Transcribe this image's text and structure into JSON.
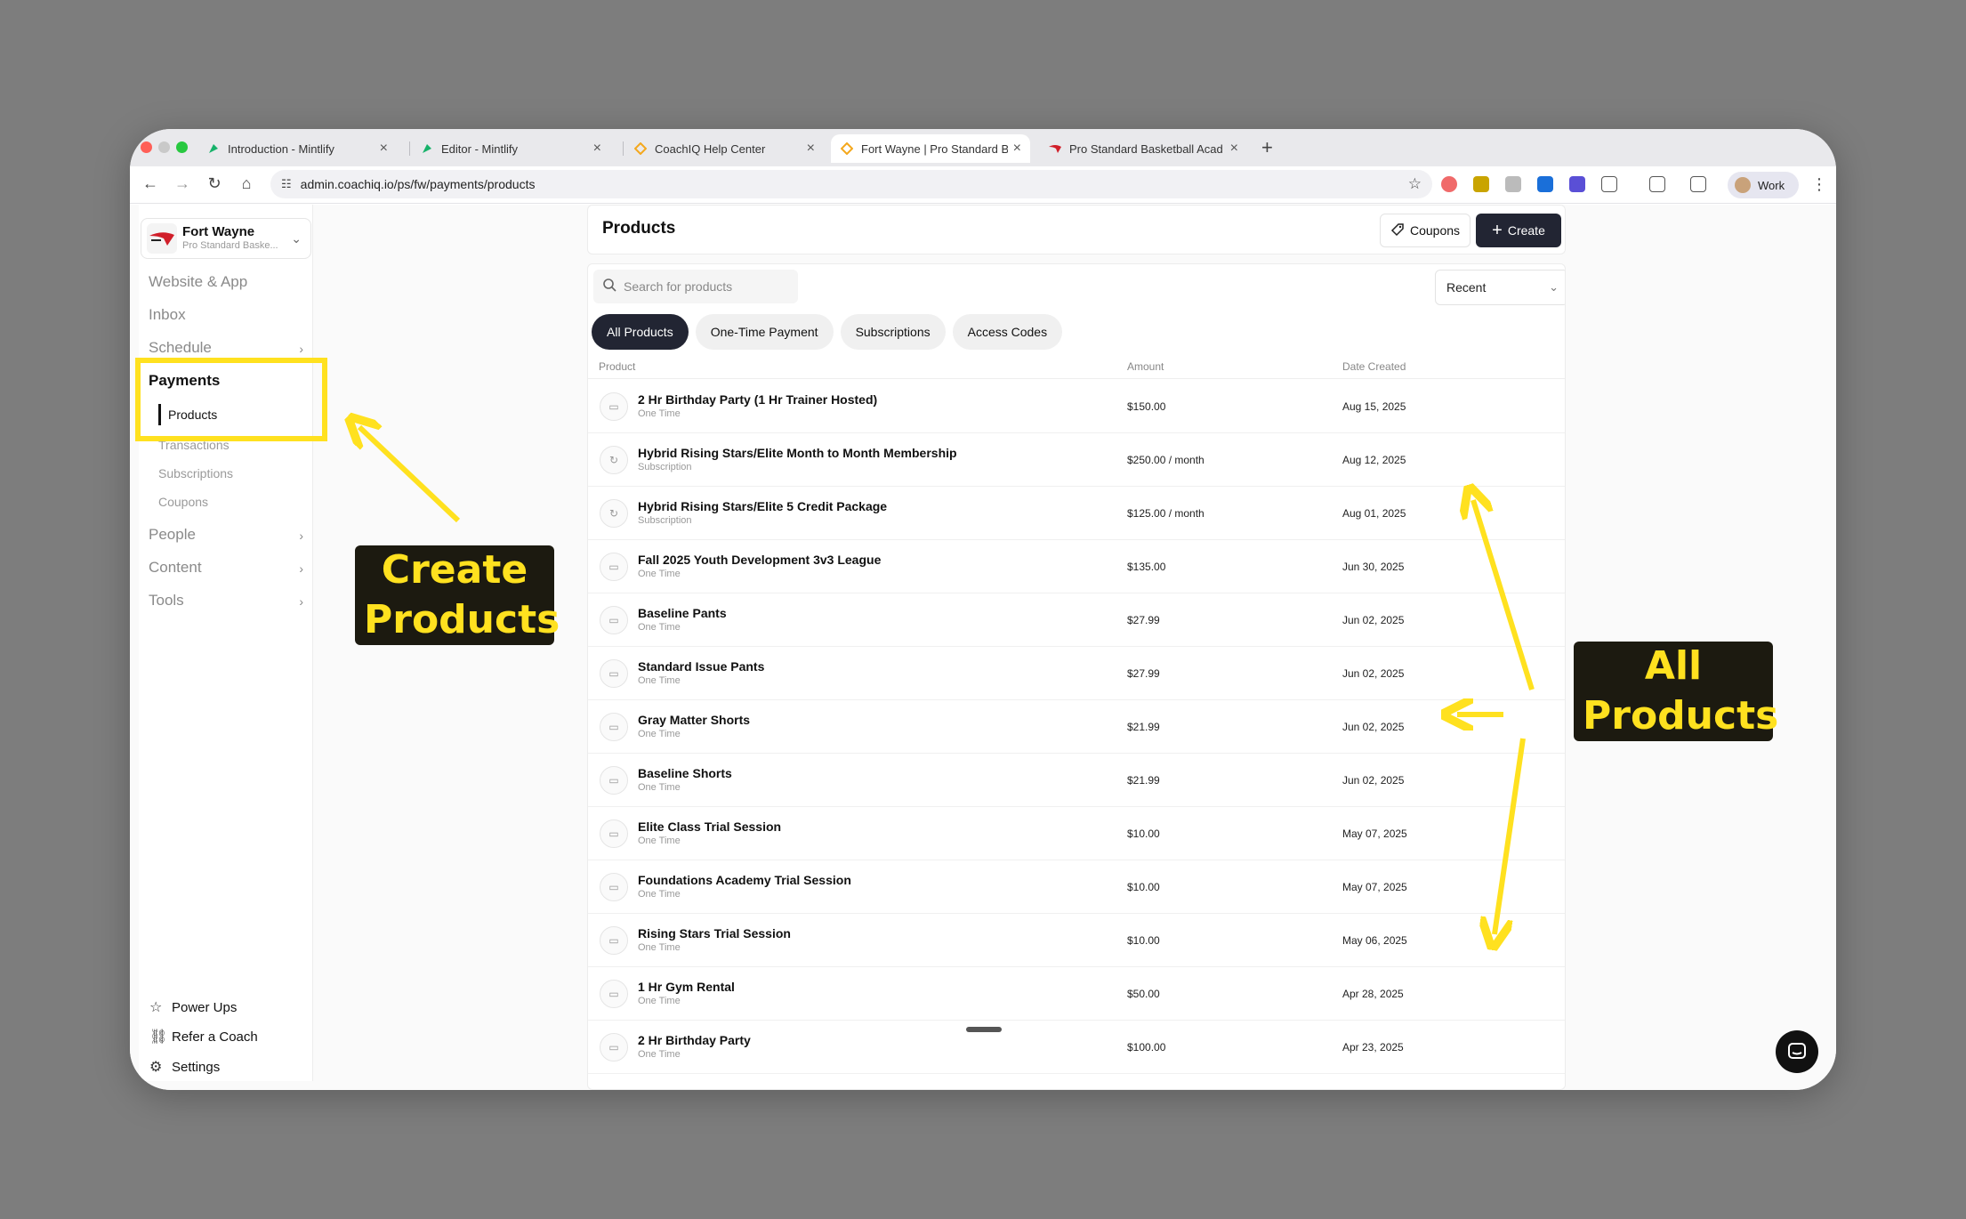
{
  "browser": {
    "tabs": [
      {
        "title": "Introduction - Mintlify",
        "active": false
      },
      {
        "title": "Editor - Mintlify",
        "active": false
      },
      {
        "title": "CoachIQ Help Center",
        "active": false
      },
      {
        "title": "Fort Wayne | Pro Standard Ba",
        "active": true
      },
      {
        "title": "Pro Standard Basketball Acad",
        "active": false
      }
    ],
    "url": "admin.coachiq.io/ps/fw/payments/products",
    "profile_label": "Work",
    "accent": "#ffe11f"
  },
  "org": {
    "name": "Fort Wayne",
    "subtitle": "Pro Standard Baske..."
  },
  "sidebar": {
    "website_app": "Website & App",
    "inbox": "Inbox",
    "schedule": "Schedule",
    "payments": "Payments",
    "payments_sub": [
      "Products",
      "Transactions",
      "Subscriptions",
      "Coupons"
    ],
    "people": "People",
    "content": "Content",
    "tools": "Tools",
    "footer": [
      "Power Ups",
      "Refer a Coach",
      "Settings"
    ]
  },
  "header": {
    "title": "Products",
    "coupons_label": "Coupons",
    "create_label": "Create"
  },
  "list": {
    "search_placeholder": "Search for products",
    "sort_value": "Recent",
    "filters": [
      "All Products",
      "One-Time Payment",
      "Subscriptions",
      "Access Codes"
    ],
    "columns": {
      "product": "Product",
      "amount": "Amount",
      "date": "Date Created"
    },
    "rows": [
      {
        "name": "2 Hr Birthday Party (1 Hr Trainer Hosted)",
        "type": "One Time",
        "amount": "$150.00",
        "date": "Aug 15, 2025",
        "icon": "ticket"
      },
      {
        "name": "Hybrid Rising Stars/Elite Month to Month Membership",
        "type": "Subscription",
        "amount": "$250.00 / month",
        "date": "Aug 12, 2025",
        "icon": "refresh"
      },
      {
        "name": "Hybrid Rising Stars/Elite 5 Credit Package",
        "type": "Subscription",
        "amount": "$125.00 / month",
        "date": "Aug 01, 2025",
        "icon": "refresh"
      },
      {
        "name": "Fall 2025 Youth Development 3v3 League",
        "type": "One Time",
        "amount": "$135.00",
        "date": "Jun 30, 2025",
        "icon": "ticket"
      },
      {
        "name": "Baseline Pants",
        "type": "One Time",
        "amount": "$27.99",
        "date": "Jun 02, 2025",
        "icon": "ticket"
      },
      {
        "name": "Standard Issue Pants",
        "type": "One Time",
        "amount": "$27.99",
        "date": "Jun 02, 2025",
        "icon": "ticket"
      },
      {
        "name": "Gray Matter Shorts",
        "type": "One Time",
        "amount": "$21.99",
        "date": "Jun 02, 2025",
        "icon": "ticket"
      },
      {
        "name": "Baseline Shorts",
        "type": "One Time",
        "amount": "$21.99",
        "date": "Jun 02, 2025",
        "icon": "ticket"
      },
      {
        "name": "Elite Class Trial Session",
        "type": "One Time",
        "amount": "$10.00",
        "date": "May 07, 2025",
        "icon": "ticket"
      },
      {
        "name": "Foundations Academy Trial Session",
        "type": "One Time",
        "amount": "$10.00",
        "date": "May 07, 2025",
        "icon": "ticket"
      },
      {
        "name": "Rising Stars Trial Session",
        "type": "One Time",
        "amount": "$10.00",
        "date": "May 06, 2025",
        "icon": "ticket"
      },
      {
        "name": "1 Hr Gym Rental",
        "type": "One Time",
        "amount": "$50.00",
        "date": "Apr 28, 2025",
        "icon": "ticket"
      },
      {
        "name": "2 Hr Birthday Party",
        "type": "One Time",
        "amount": "$100.00",
        "date": "Apr 23, 2025",
        "icon": "ticket"
      }
    ]
  },
  "annotations": {
    "create_products": "Create Products",
    "all_products": "All Products"
  }
}
